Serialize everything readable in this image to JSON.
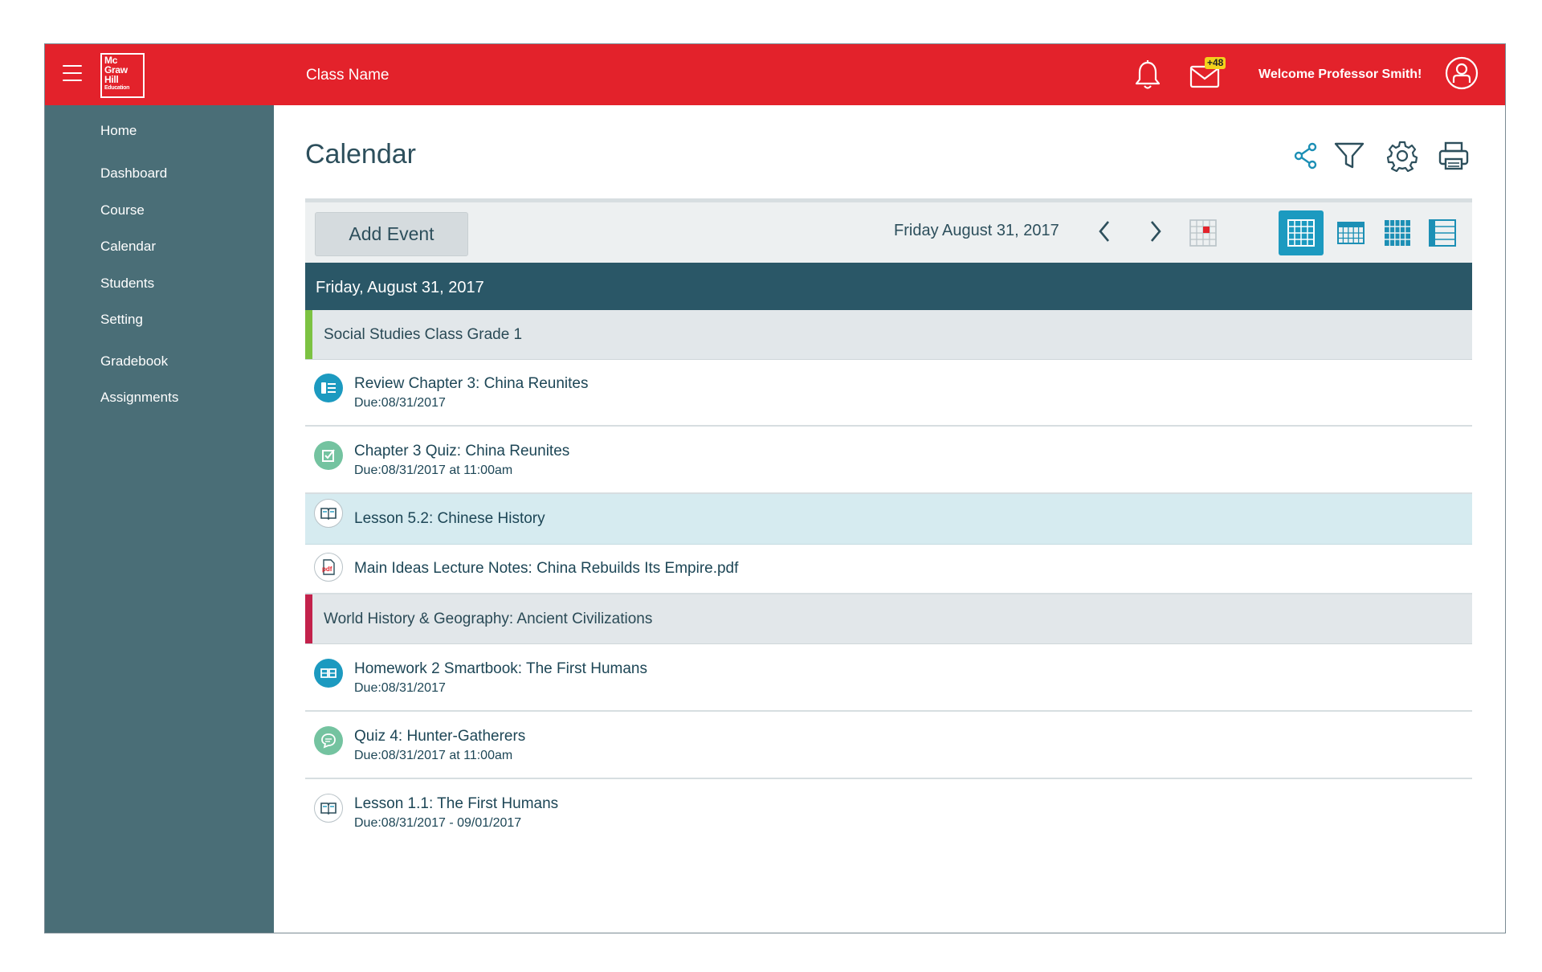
{
  "header": {
    "logo_lines": [
      "Mc",
      "Graw",
      "Hill",
      "Education"
    ],
    "class_name": "Class Name",
    "mail_badge": "+48",
    "welcome": "Welcome Professor Smith!",
    "brand_color": "#e3222b",
    "icons": [
      "menu-icon",
      "bell-icon",
      "mail-icon",
      "user-icon"
    ]
  },
  "sidebar": {
    "items": [
      {
        "label": "Home"
      },
      {
        "label": "Dashboard"
      },
      {
        "label": "Course"
      },
      {
        "label": "Calendar"
      },
      {
        "label": "Students"
      },
      {
        "label": "Setting"
      },
      {
        "label": "Gradebook"
      },
      {
        "label": "Assignments"
      }
    ]
  },
  "main": {
    "title": "Calendar",
    "tools": [
      "share-icon",
      "filter-icon",
      "settings-icon",
      "print-icon"
    ],
    "toolbar": {
      "add_event_label": "Add Event",
      "current_date": "Friday August 31, 2017",
      "views": [
        "day-view",
        "week-view",
        "month-view",
        "list-view"
      ],
      "active_view": "day-view",
      "accent_color": "#1c9ac0"
    },
    "day_header": "Friday, August 31, 2017",
    "groups": [
      {
        "label": "Social Studies Class Grade 1",
        "color": "#7cc242",
        "items": [
          {
            "title": "Review Chapter 3: China Reunites",
            "sub": "Due:08/31/2017",
            "icon": "review-icon"
          },
          {
            "title": "Chapter 3 Quiz: China Reunites",
            "sub": "Due:08/31/2017 at 11:00am",
            "icon": "quiz-icon"
          },
          {
            "title": "Lesson 5.2: Chinese History",
            "sub": "",
            "icon": "book-icon",
            "highlighted": true
          },
          {
            "title": "Main Ideas Lecture Notes: China Rebuilds Its Empire.pdf",
            "sub": "",
            "icon": "pdf-icon"
          }
        ]
      },
      {
        "label": "World History & Geography: Ancient Civilizations",
        "color": "#c3224b",
        "items": [
          {
            "title": "Homework 2 Smartbook: The First Humans",
            "sub": "Due:08/31/2017",
            "icon": "smartbook-icon"
          },
          {
            "title": "Quiz 4: Hunter-Gatherers",
            "sub": "Due:08/31/2017 at 11:00am",
            "icon": "chat-quiz-icon"
          },
          {
            "title": "Lesson 1.1: The First Humans",
            "sub": "Due:08/31/2017 - 09/01/2017",
            "icon": "book-icon"
          }
        ]
      }
    ]
  }
}
